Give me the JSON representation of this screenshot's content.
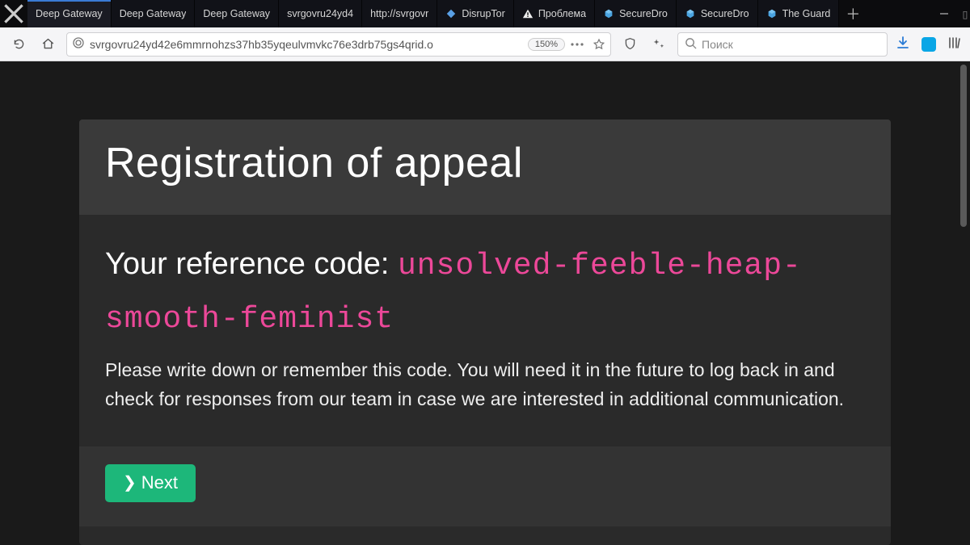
{
  "browser": {
    "tabs": [
      {
        "label": "Deep Gateway",
        "icon": null,
        "active": true
      },
      {
        "label": "Deep Gateway",
        "icon": null
      },
      {
        "label": "Deep Gateway",
        "icon": null
      },
      {
        "label": "svrgovru24yd4",
        "icon": null
      },
      {
        "label": "http://svrgovr",
        "icon": null
      },
      {
        "label": "DisrupTor",
        "icon": "diamond"
      },
      {
        "label": "Проблема",
        "icon": "warning"
      },
      {
        "label": "SecureDro",
        "icon": "cube"
      },
      {
        "label": "SecureDro",
        "icon": "cube"
      },
      {
        "label": "The Guard",
        "icon": "cube"
      }
    ],
    "url": "svrgovru24yd42e6mmrnohzs37hb35yqeulvmvkc76e3drb75gs4qrid.o",
    "zoom": "150%",
    "search_placeholder": "Поиск"
  },
  "page": {
    "title": "Registration of appeal",
    "ref_label": "Your reference code:",
    "ref_code": "unsolved-feeble-heap-smooth-feminist",
    "instructions": "Please write down or remember this code. You will need it in the future to log back in and check for responses from our team in case we are interested in additional communication.",
    "next_label": "Next"
  },
  "colors": {
    "accent_green": "#1db77a",
    "code_pink": "#ec4899"
  }
}
